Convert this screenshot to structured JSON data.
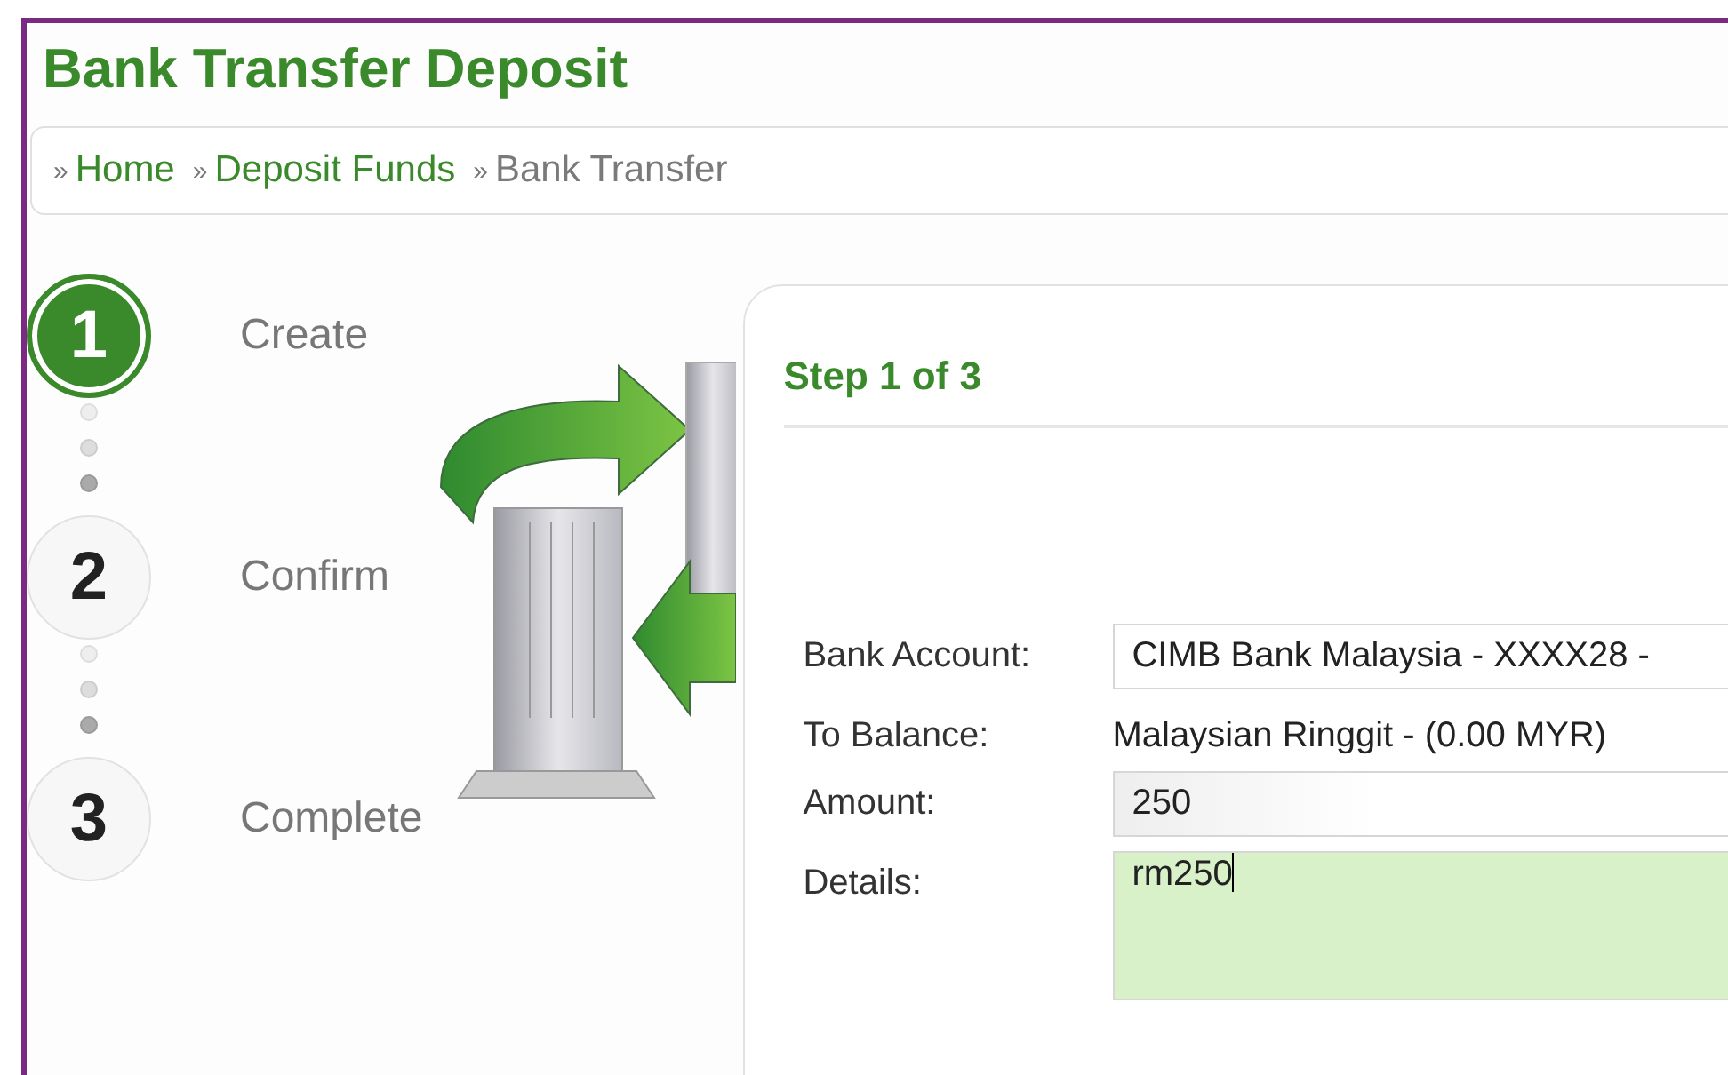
{
  "page": {
    "title": "Bank Transfer Deposit"
  },
  "breadcrumb": [
    {
      "separator": "»",
      "label": "Home",
      "kind": "link"
    },
    {
      "separator": "»",
      "label": "Deposit Funds",
      "kind": "link"
    },
    {
      "separator": "»",
      "label": "Bank Transfer",
      "kind": "current"
    }
  ],
  "steps": [
    {
      "number": "1",
      "label": "Create",
      "selected": true
    },
    {
      "number": "2",
      "label": "Confirm",
      "selected": false
    },
    {
      "number": "3",
      "label": "Complete",
      "selected": false
    }
  ],
  "form": {
    "heading": "Step 1 of 3",
    "fields": [
      {
        "kind": "select",
        "label": "Bank Account:",
        "value": "CIMB Bank Malaysia - XXXX28 -"
      },
      {
        "kind": "static",
        "label": "To Balance:",
        "value": "Malaysian Ringgit - (0.00 MYR)"
      },
      {
        "kind": "text",
        "label": "Amount:",
        "value": "250"
      },
      {
        "kind": "textarea",
        "label": "Details:",
        "value": "rm250",
        "focused": true
      }
    ]
  }
}
